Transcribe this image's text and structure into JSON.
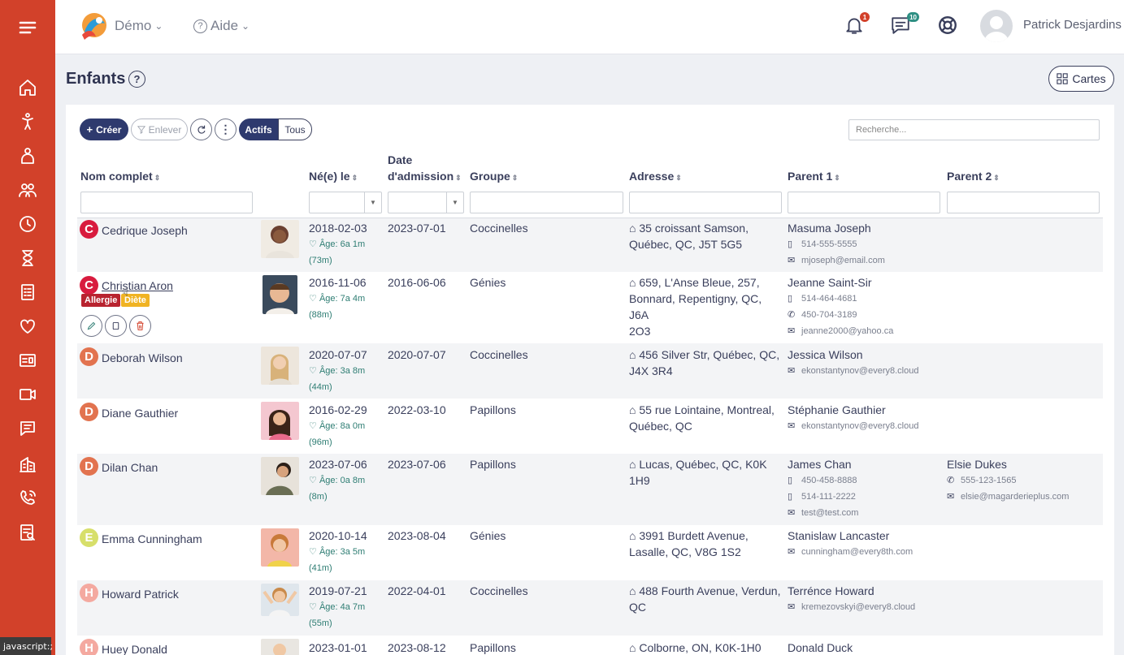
{
  "topbar": {
    "demo_label": "Démo",
    "help_label": "Aide",
    "notifications_count": "1",
    "messages_count": "10",
    "user_name": "Patrick Desjardins"
  },
  "page": {
    "title": "Enfants",
    "cards_label": "Cartes"
  },
  "toolbar": {
    "create_label": "Créer",
    "remove_label": "Enlever",
    "active_label": "Actifs",
    "all_label": "Tous",
    "search_placeholder": "Recherche..."
  },
  "columns": {
    "name": "Nom complet",
    "born": "Né(e) le",
    "admission_line1": "Date",
    "admission_line2": "d'admission",
    "group": "Groupe",
    "address": "Adresse",
    "parent1": "Parent 1",
    "parent2": "Parent 2"
  },
  "rows": [
    {
      "initial": "C",
      "name": "Cedrique Joseph",
      "born": "2018-02-03",
      "age": "Âge: 6a 1m",
      "months": "(73m)",
      "admission": "2023-07-01",
      "group": "Coccinelles",
      "address1": "35 croissant Samson,",
      "address2": "Québec, QC, J5T 5G5",
      "address3": "",
      "p1_name": "Masuma Joseph",
      "p1_c1": "514-555-5555",
      "p1_c2": "mjoseph@email.com",
      "p1_c3": "",
      "p2_name": "",
      "p2_c1": "",
      "p2_c2": ""
    },
    {
      "initial": "C",
      "name": "Christian Aron",
      "born": "2016-11-06",
      "age": "Âge: 7a 4m",
      "months": "(88m)",
      "admission": "2016-06-06",
      "group": "Génies",
      "address1": "659, L'Anse Bleue, 257,",
      "address2": "Bonnard, Repentigny, QC, J6A",
      "address3": "2O3",
      "p1_name": "Jeanne Saint-Sir",
      "p1_c1": "514-464-4681",
      "p1_c2": "450-704-3189",
      "p1_c3": "jeanne2000@yahoo.ca",
      "p2_name": "",
      "p2_c1": "",
      "p2_c2": "",
      "tag_allergy": "Allergie",
      "tag_diet": "Diète"
    },
    {
      "initial": "D",
      "name": "Deborah Wilson",
      "born": "2020-07-07",
      "age": "Âge: 3a 8m",
      "months": "(44m)",
      "admission": "2020-07-07",
      "group": "Coccinelles",
      "address1": "456 Silver Str, Québec, QC,",
      "address2": "J4X 3R4",
      "address3": "",
      "p1_name": "Jessica Wilson",
      "p1_c1": "ekonstantynov@every8.cloud",
      "p1_c2": "",
      "p1_c3": "",
      "p2_name": "",
      "p2_c1": "",
      "p2_c2": ""
    },
    {
      "initial": "D",
      "name": "Diane Gauthier",
      "born": "2016-02-29",
      "age": "Âge: 8a 0m",
      "months": "(96m)",
      "admission": "2022-03-10",
      "group": "Papillons",
      "address1": "55 rue Lointaine, Montreal,",
      "address2": "Québec, QC",
      "address3": "",
      "p1_name": "Stéphanie Gauthier",
      "p1_c1": "ekonstantynov@every8.cloud",
      "p1_c2": "",
      "p1_c3": "",
      "p2_name": "",
      "p2_c1": "",
      "p2_c2": ""
    },
    {
      "initial": "D",
      "name": "Dilan Chan",
      "born": "2023-07-06",
      "age": "Âge: 0a 8m",
      "months": "(8m)",
      "admission": "2023-07-06",
      "group": "Papillons",
      "address1": "Lucas, Québec, QC, K0K 1H9",
      "address2": "",
      "address3": "",
      "p1_name": "James Chan",
      "p1_c1": "450-458-8888",
      "p1_c2": "514-111-2222",
      "p1_c3": "test@test.com",
      "p2_name": "Elsie Dukes",
      "p2_c1": "555-123-1565",
      "p2_c2": "elsie@magarderieplus.com"
    },
    {
      "initial": "E",
      "name": "Emma Cunningham",
      "born": "2020-10-14",
      "age": "Âge: 3a 5m",
      "months": "(41m)",
      "admission": "2023-08-04",
      "group": "Génies",
      "address1": "3991 Burdett Avenue,",
      "address2": "Lasalle, QC, V8G 1S2",
      "address3": "",
      "p1_name": "Stanislaw Lancaster",
      "p1_c1": "cunningham@every8th.com",
      "p1_c2": "",
      "p1_c3": "",
      "p2_name": "",
      "p2_c1": "",
      "p2_c2": ""
    },
    {
      "initial": "H",
      "name": "Howard Patrick",
      "born": "2019-07-21",
      "age": "Âge: 4a 7m",
      "months": "(55m)",
      "admission": "2022-04-01",
      "group": "Coccinelles",
      "address1": "488 Fourth Avenue, Verdun,",
      "address2": "QC",
      "address3": "",
      "p1_name": "Terrénce Howard",
      "p1_c1": "kremezovskyi@every8.cloud",
      "p1_c2": "",
      "p1_c3": "",
      "p2_name": "",
      "p2_c1": "",
      "p2_c2": ""
    },
    {
      "initial": "H",
      "name": "Huey Donald",
      "born": "2023-01-01",
      "age": "",
      "months": "",
      "admission": "2023-08-12",
      "group": "Papillons",
      "address1": "Colborne, ON, K0K-1H0",
      "address2": "",
      "address3": "",
      "p1_name": "Donald Duck",
      "p1_c1": "",
      "p1_c2": "",
      "p1_c3": "",
      "p2_name": "",
      "p2_c1": "",
      "p2_c2": ""
    }
  ],
  "statusbar": {
    "text": "javascript:;"
  },
  "colors": {
    "sidebar": "#d2412a",
    "primary": "#2e3a6e",
    "initial_C": "#d81b3e",
    "initial_D": "#e2734f",
    "initial_E": "#d7df6a",
    "initial_H": "#f4a9a0"
  }
}
